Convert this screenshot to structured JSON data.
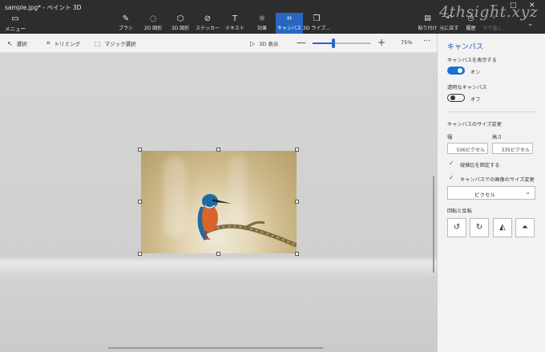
{
  "window": {
    "title": "sample.jpg* - ペイント 3D",
    "watermark": "4thsight.xyz"
  },
  "toolbar": {
    "menu": {
      "label": "メニュー",
      "icon": "folder-icon"
    },
    "tools": [
      {
        "label": "ブラシ",
        "icon": "brush-icon",
        "active": false
      },
      {
        "label": "2D 図形",
        "icon": "2d-shapes-icon",
        "active": false
      },
      {
        "label": "3D 図形",
        "icon": "3d-shapes-icon",
        "active": false
      },
      {
        "label": "ステッカー",
        "icon": "sticker-icon",
        "active": false
      },
      {
        "label": "テキスト",
        "icon": "text-icon",
        "active": false
      },
      {
        "label": "効果",
        "icon": "effects-icon",
        "active": false
      },
      {
        "label": "キャンバス",
        "icon": "canvas-icon",
        "active": true
      },
      {
        "label": "3D ライブ...",
        "icon": "3d-library-icon",
        "active": false
      }
    ],
    "right": [
      {
        "label": "貼り付け",
        "icon": "paste-icon"
      },
      {
        "label": "元に戻す",
        "icon": "undo-icon"
      },
      {
        "label": "履歴",
        "icon": "history-icon"
      },
      {
        "label": "やり直し",
        "icon": "redo-icon"
      }
    ],
    "window_controls": {
      "minimize": "—",
      "maximize": "□",
      "close": "✕",
      "expand": "⌄"
    }
  },
  "subtoolbar": {
    "select": "選択",
    "crop": "トリミング",
    "magic_select": "マジック選択",
    "view3d": "3D 表示",
    "zoom_minus": "—",
    "zoom_plus": "+",
    "zoom_percent": "75%",
    "zoom_level": 0.36,
    "more": "···"
  },
  "panel": {
    "title": "キャンバス",
    "show_canvas": {
      "label": "キャンバスを表示する",
      "state": "オン"
    },
    "transparent": {
      "label": "透明なキャンバス",
      "state": "オフ"
    },
    "resize_title": "キャンバスのサイズ変更",
    "width_label": "幅",
    "height_label": "高さ",
    "width_value": "506ピクセル",
    "height_value": "335ピクセル",
    "lock_aspect": "縦横比を固定する",
    "resize_image": "キャンバスでの画像のサイズ変更",
    "unit": "ピクセル",
    "rotate_title": "回転と反転"
  },
  "colors": {
    "accent": "#2966c4",
    "toggle_on": "#1a6ed8",
    "topbar": "#2d2d2d"
  }
}
